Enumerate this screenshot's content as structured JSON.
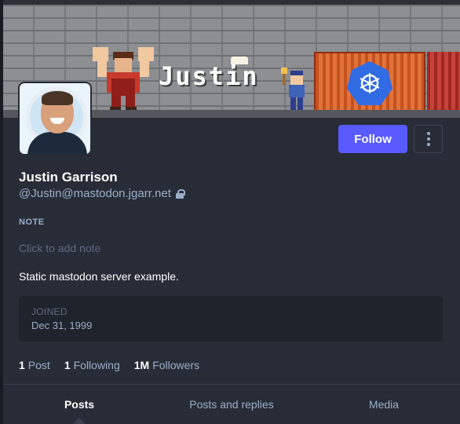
{
  "profile": {
    "header_title": "Justin",
    "display_name": "Justin Garrison",
    "handle": "@Justin@mastodon.jgarr.net",
    "bio": "Static mastodon server example.",
    "locked_icon": "lock-icon",
    "avatar_icon": "avatar"
  },
  "actions": {
    "follow_label": "Follow",
    "menu_icon": "kebab-menu-icon"
  },
  "note": {
    "label": "NOTE",
    "placeholder": "Click to add note"
  },
  "joined": {
    "label": "JOINED",
    "value": "Dec 31, 1999"
  },
  "stats": {
    "posts_count": "1",
    "posts_label": "Post",
    "following_count": "1",
    "following_label": "Following",
    "followers_count": "1M",
    "followers_label": "Followers"
  },
  "tabs": [
    {
      "label": "Posts",
      "active": true
    },
    {
      "label": "Posts and replies",
      "active": false
    },
    {
      "label": "Media",
      "active": false
    }
  ],
  "colors": {
    "accent": "#595aff",
    "background": "#282c37",
    "muted_text": "#9baec8",
    "dim_text": "#606984"
  }
}
